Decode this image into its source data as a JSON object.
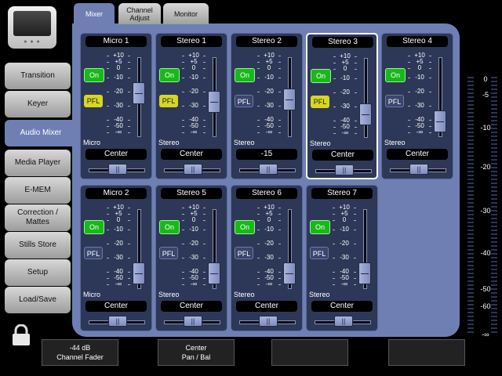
{
  "tabs": [
    {
      "label": "Mixer"
    },
    {
      "label": "Channel Adjust"
    },
    {
      "label": "Monitor"
    }
  ],
  "sidebar": {
    "items": [
      {
        "label": "Transition"
      },
      {
        "label": "Keyer"
      },
      {
        "label": "Audio Mixer"
      },
      {
        "label": "Media Player"
      },
      {
        "label": "E-MEM"
      },
      {
        "label": "Correction / Mattes"
      },
      {
        "label": "Stills Store"
      },
      {
        "label": "Setup"
      },
      {
        "label": "Load/Save"
      }
    ]
  },
  "scale_labels": [
    "+10",
    "+5",
    "0",
    "-10",
    "-20",
    "-30",
    "-40",
    "-50",
    "-∞"
  ],
  "channels": [
    {
      "name": "Micro 1",
      "on_label": "On",
      "pfl_label": "PFL",
      "pfl_active": true,
      "source": "Micro",
      "pan": "Center",
      "fader_level": 0.55
    },
    {
      "name": "Stereo 1",
      "on_label": "On",
      "pfl_label": "PFL",
      "pfl_active": true,
      "source": "Stereo",
      "pan": "Center",
      "fader_level": 0.4
    },
    {
      "name": "Stereo 2",
      "on_label": "On",
      "pfl_label": "PFL",
      "pfl_active": false,
      "source": "Stereo",
      "pan": "-15",
      "fader_level": 0.45
    },
    {
      "name": "Stereo 3",
      "on_label": "On",
      "pfl_label": "PFL",
      "pfl_active": true,
      "source": "Stereo",
      "pan": "Center",
      "fader_level": 0.2,
      "selected": true
    },
    {
      "name": "Stereo 4",
      "on_label": "On",
      "pfl_label": "PFL",
      "pfl_active": false,
      "source": "Stereo",
      "pan": "Center",
      "fader_level": 0.05
    },
    {
      "name": "Micro 2",
      "on_label": "On",
      "pfl_label": "PFL",
      "pfl_active": false,
      "source": "Micro",
      "pan": "Center",
      "fader_level": 0.05
    },
    {
      "name": "Stereo 5",
      "on_label": "On",
      "pfl_label": "PFL",
      "pfl_active": false,
      "source": "Stereo",
      "pan": "Center",
      "fader_level": 0.05
    },
    {
      "name": "Stereo 6",
      "on_label": "On",
      "pfl_label": "PFL",
      "pfl_active": false,
      "source": "Stereo",
      "pan": "Center",
      "fader_level": 0.05
    },
    {
      "name": "Stereo 7",
      "on_label": "On",
      "pfl_label": "PFL",
      "pfl_active": false,
      "source": "Stereo",
      "pan": "Center",
      "fader_level": 0.05
    }
  ],
  "meter": {
    "labels": [
      "0",
      "-5",
      "-10",
      "-20",
      "-30",
      "-40",
      "-50",
      "-60",
      "-∞"
    ]
  },
  "footer": {
    "fader_value": "-44 dB",
    "fader_label": "Channel Fader",
    "pan_value": "Center",
    "pan_label": "Pan / Bal"
  },
  "colors": {
    "panel": "#6f7fb3",
    "strip": "#2d3858",
    "on_green": "#18b818",
    "pfl_yellow": "#d7d721"
  }
}
